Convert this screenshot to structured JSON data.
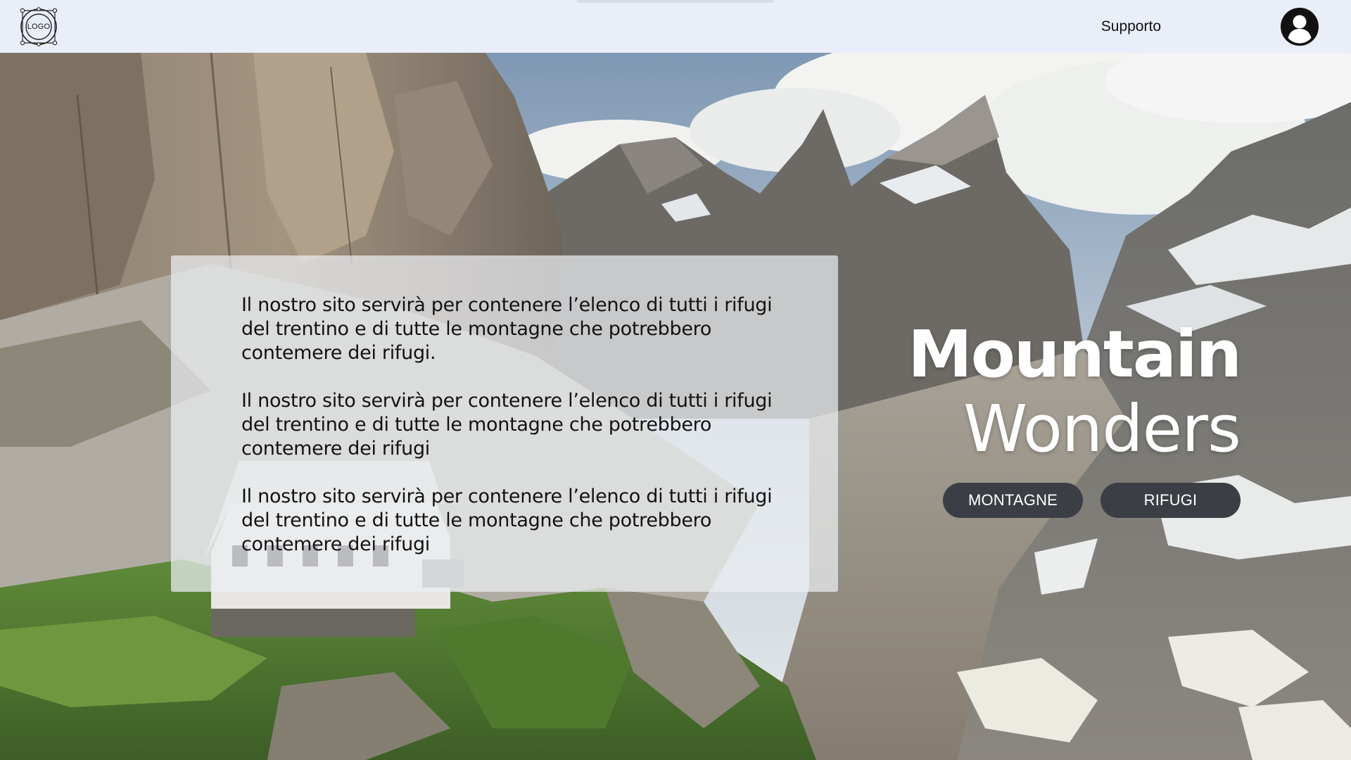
{
  "header": {
    "logo_text": "LOGO",
    "support_label": "Supporto",
    "avatar_icon": "user-circle-icon",
    "logo_icon": "logo-badge-icon"
  },
  "hero": {
    "description": [
      "Il nostro sito servirà per contenere l’elenco di tutti i rifugi del trentino e di tutte le montagne che potrebbero contemere dei rifugi.",
      "Il nostro sito servirà per contenere l’elenco di tutti i rifugi del trentino e di tutte le montagne che potrebbero contemere dei rifugi",
      "Il nostro sito servirà per contenere l’elenco di tutti i rifugi del trentino e di tutte le montagne che potrebbero contemere dei rifugi"
    ],
    "title_bold": "Mountain",
    "title_regular": "Wonders",
    "buttons": {
      "mountains": "MONTAGNE",
      "huts": "RIFUGI"
    }
  },
  "colors": {
    "navbar_bg": "#e9eef9",
    "button_bg": "#3b3e44",
    "title_color": "#ffffff"
  }
}
